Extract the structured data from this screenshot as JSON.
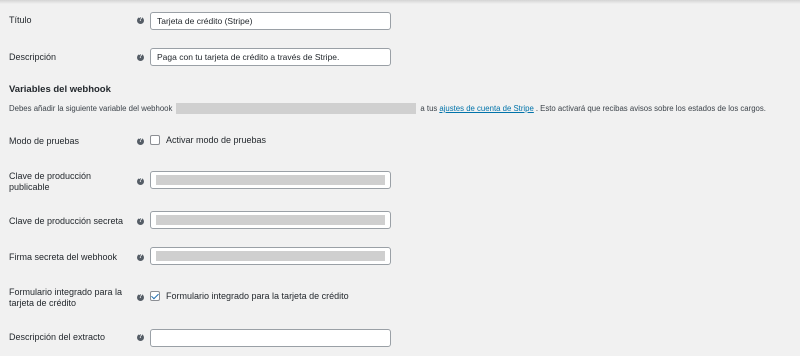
{
  "fields": {
    "title": {
      "label": "Título",
      "value": "Tarjeta de crédito (Stripe)"
    },
    "description": {
      "label": "Descripción",
      "value": "Paga con tu tarjeta de crédito a través de Stripe."
    },
    "webhook_heading": "Variables del webhook",
    "webhook_text_before": "Debes añadir la siguiente variable del webhook",
    "webhook_text_middle": "a tus",
    "webhook_link": "ajustes de cuenta de Stripe",
    "webhook_text_after": ". Esto activará que recibas avisos sobre los estados de los cargos.",
    "test_mode": {
      "label": "Modo de pruebas",
      "checkbox_label": "Activar modo de pruebas",
      "checked": false
    },
    "publishable_key": {
      "label_line1": "Clave de producción",
      "label_line2": "publicable"
    },
    "secret_key": {
      "label": "Clave de producción secreta"
    },
    "webhook_secret": {
      "label": "Firma secreta del webhook"
    },
    "inline_form": {
      "label_line1": "Formulario integrado para la",
      "label_line2": "tarjeta de crédito",
      "checkbox_label": "Formulario integrado para la tarjeta de crédito",
      "checked": true
    },
    "statement_descriptor": {
      "label": "Descripción del extracto",
      "value": ""
    }
  },
  "help_glyph": "?",
  "colors": {
    "link": "#0073aa",
    "checkmark": "#2271b1"
  }
}
